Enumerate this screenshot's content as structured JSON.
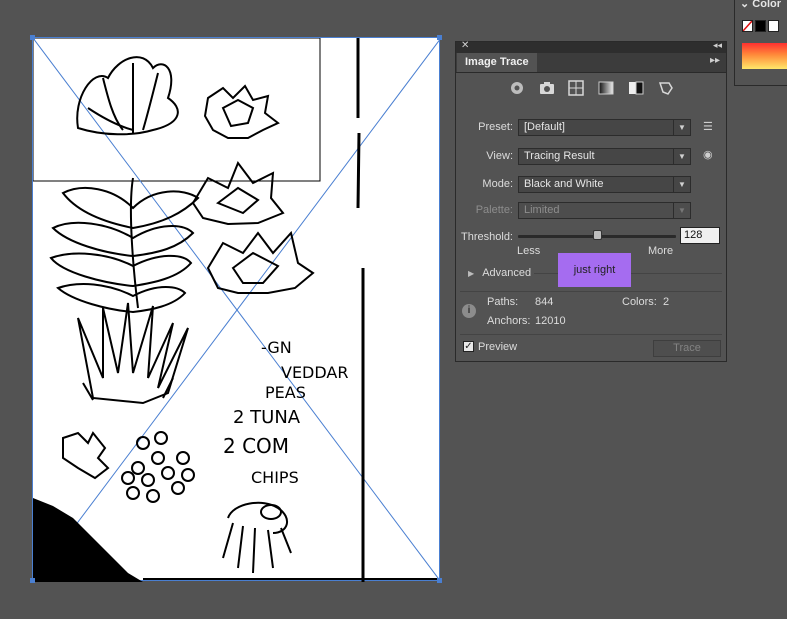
{
  "color_panel": {
    "title": "Color",
    "swatch_none_color": "#ffffff",
    "swatch_black": "#000000",
    "swatch_white": "#ffffff"
  },
  "panel": {
    "close": "✕",
    "collapse": "◂◂",
    "tab_label": "Image Trace",
    "menu": "▸▸",
    "icons": [
      "auto-color-icon",
      "high-color-icon",
      "low-color-icon",
      "grayscale-icon",
      "black-white-icon",
      "outline-icon"
    ],
    "preset_label": "Preset:",
    "preset_value": "[Default]",
    "view_label": "View:",
    "view_value": "Tracing Result",
    "mode_label": "Mode:",
    "mode_value": "Black and White",
    "palette_label": "Palette:",
    "palette_value": "Limited",
    "threshold_label": "Threshold:",
    "threshold_value": "128",
    "threshold_level": 0.5,
    "less_label": "Less",
    "more_label": "More",
    "advanced_label": "Advanced",
    "annotation": "just right",
    "paths_label": "Paths:",
    "paths_value": "844",
    "colors_label": "Colors:",
    "colors_value": "2",
    "anchors_label": "Anchors:",
    "anchors_value": "12010",
    "preview_label": "Preview",
    "preview_checked": true,
    "trace_button": "Trace"
  },
  "artboard": {
    "handwriting": [
      "-GN",
      "VEDDAR",
      "PEAS",
      "2 TUNA",
      "2 COM",
      "CHIPS"
    ],
    "accent_color": "#4a7fd1"
  }
}
